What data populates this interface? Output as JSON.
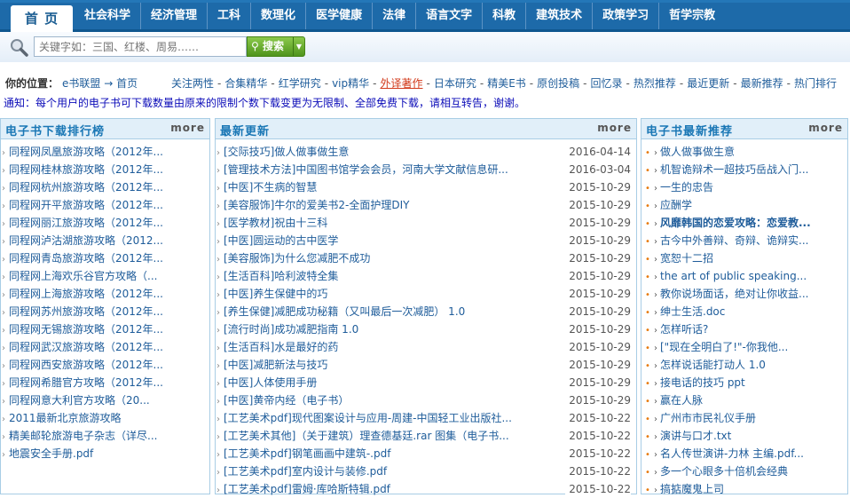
{
  "nav": {
    "home": "首 页",
    "items": [
      "社会科学",
      "经济管理",
      "工科",
      "数理化",
      "医学健康",
      "法律",
      "语言文字",
      "科教",
      "建筑技术",
      "政策学习",
      "哲学宗教"
    ]
  },
  "search": {
    "placeholder": "关键字如：三国、红楼、周易……",
    "button": "搜索"
  },
  "breadcrumb": {
    "label": "你的位置：",
    "path": "e书联盟 → 首页"
  },
  "quick_links": [
    "关注两性",
    "合集精华",
    "红学研究",
    "vip精华",
    "外译著作",
    "日本研究",
    "精美E书",
    "原创投稿",
    "回忆录",
    "热烈推荐",
    "最近更新",
    "最新推荐",
    "热门排行"
  ],
  "notice": "通知：每个用户的电子书可下载数量由原来的限制个数下载变更为无限制、全部免费下载，请相互转告，谢谢。",
  "ranking": {
    "title": "电子书下载排行榜",
    "more": "more",
    "items": [
      "同程网凤凰旅游攻略（2012年...",
      "同程网桂林旅游攻略（2012年...",
      "同程网杭州旅游攻略（2012年...",
      "同程网开平旅游攻略（2012年...",
      "同程网丽江旅游攻略（2012年...",
      "同程网泸沽湖旅游攻略（2012...",
      "同程网青岛旅游攻略（2012年...",
      "同程网上海欢乐谷官方攻略（...",
      "同程网上海旅游攻略（2012年...",
      "同程网苏州旅游攻略（2012年...",
      "同程网无锡旅游攻略（2012年...",
      "同程网武汉旅游攻略（2012年...",
      "同程网西安旅游攻略（2012年...",
      "同程网希腊官方攻略（2012年...",
      "同程网意大利官方攻略（20...",
      "2011最新北京旅游攻略",
      "精美邮轮旅游电子杂志（详尽...",
      "地震安全手册.pdf"
    ]
  },
  "updates": {
    "title": "最新更新",
    "more": "more",
    "items": [
      {
        "title": "[交际技巧]做人做事做生意",
        "date": "2016-04-14"
      },
      {
        "title": "[管理技术方法]中国图书馆学会会员，河南大学文献信息研...",
        "date": "2016-03-04"
      },
      {
        "title": "[中医]不生病的智慧",
        "date": "2015-10-29"
      },
      {
        "title": "[美容服饰]牛尔的爱美书2-全面护理DIY",
        "date": "2015-10-29"
      },
      {
        "title": "[医学教材]祝由十三科",
        "date": "2015-10-29"
      },
      {
        "title": "[中医]圆运动的古中医学",
        "date": "2015-10-29"
      },
      {
        "title": "[美容服饰]为什么您减肥不成功",
        "date": "2015-10-29"
      },
      {
        "title": "[生活百科]哈利波特全集",
        "date": "2015-10-29"
      },
      {
        "title": "[中医]养生保健中的巧",
        "date": "2015-10-29"
      },
      {
        "title": "[养生保健]减肥成功秘籍（又叫最后一次减肥） 1.0",
        "date": "2015-10-29"
      },
      {
        "title": "[流行时尚]成功减肥指南 1.0",
        "date": "2015-10-29"
      },
      {
        "title": "[生活百科]水是最好的药",
        "date": "2015-10-29"
      },
      {
        "title": "[中医]减肥新法与技巧",
        "date": "2015-10-29"
      },
      {
        "title": "[中医]人体使用手册",
        "date": "2015-10-29"
      },
      {
        "title": "[中医]黄帝内经（电子书）",
        "date": "2015-10-29"
      },
      {
        "title": "[工艺美术pdf]现代图案设计与应用-周建-中国轻工业出版社...",
        "date": "2015-10-22"
      },
      {
        "title": "[工艺美术其他]（关于建筑）理查德基廷.rar 图集（电子书...",
        "date": "2015-10-22"
      },
      {
        "title": "[工艺美术pdf]钢笔画画中建筑-.pdf",
        "date": "2015-10-22"
      },
      {
        "title": "[工艺美术pdf]室内设计与装修.pdf",
        "date": "2015-10-22"
      },
      {
        "title": "[工艺美术pdf]雷姆·库哈斯特辑.pdf",
        "date": "2015-10-22"
      }
    ]
  },
  "recommended": {
    "title": "电子书最新推荐",
    "more": "more",
    "items": [
      {
        "title": "做人做事做生意",
        "bold": false
      },
      {
        "title": "机智诡辩术一超技巧岳战入门...",
        "bold": false
      },
      {
        "title": "一生的忠告",
        "bold": false
      },
      {
        "title": "应酬学",
        "bold": false
      },
      {
        "title": "风靡韩国的恋爱攻略：恋爱教...",
        "bold": true
      },
      {
        "title": "古今中外善辩、奇辩、诡辩实...",
        "bold": false
      },
      {
        "title": "宽恕十二招",
        "bold": false
      },
      {
        "title": "the art of public speaking...",
        "bold": false
      },
      {
        "title": "教你说场面话，绝对让你收益...",
        "bold": false
      },
      {
        "title": "绅士生活.doc",
        "bold": false
      },
      {
        "title": "怎样听话?",
        "bold": false
      },
      {
        "title": "[\"现在全明白了!\"-你我他...",
        "bold": false
      },
      {
        "title": "怎样说话能打动人 1.0",
        "bold": false
      },
      {
        "title": "接电话的技巧 ppt",
        "bold": false
      },
      {
        "title": "赢在人脉",
        "bold": false
      },
      {
        "title": "广州市市民礼仪手册",
        "bold": false
      },
      {
        "title": "演讲与口才.txt",
        "bold": false
      },
      {
        "title": "名人传世演讲-力林 主编.pdf...",
        "bold": false
      },
      {
        "title": "多一个心眼多十倍机会经典",
        "bold": false
      },
      {
        "title": "搞掂魔鬼上司",
        "bold": false
      }
    ]
  }
}
